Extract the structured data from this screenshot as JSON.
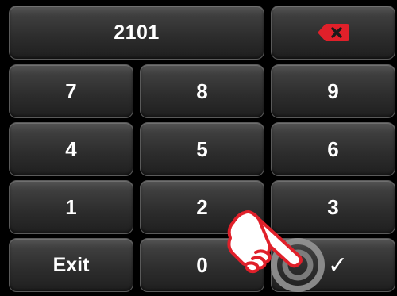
{
  "display": {
    "value": "2101"
  },
  "backspace": {
    "icon": "backspace-icon",
    "color": "#e0202a"
  },
  "keypad": {
    "keys": [
      "7",
      "8",
      "9",
      "4",
      "5",
      "6",
      "1",
      "2",
      "3"
    ],
    "exit_label": "Exit",
    "zero_label": "0",
    "confirm_label": "✓",
    "confirm_icon": "checkmark-icon"
  },
  "overlay": {
    "tap_icon": "pointing-hand-icon",
    "target_icon": "tap-target-icon",
    "hand_color": "#e0202a"
  }
}
